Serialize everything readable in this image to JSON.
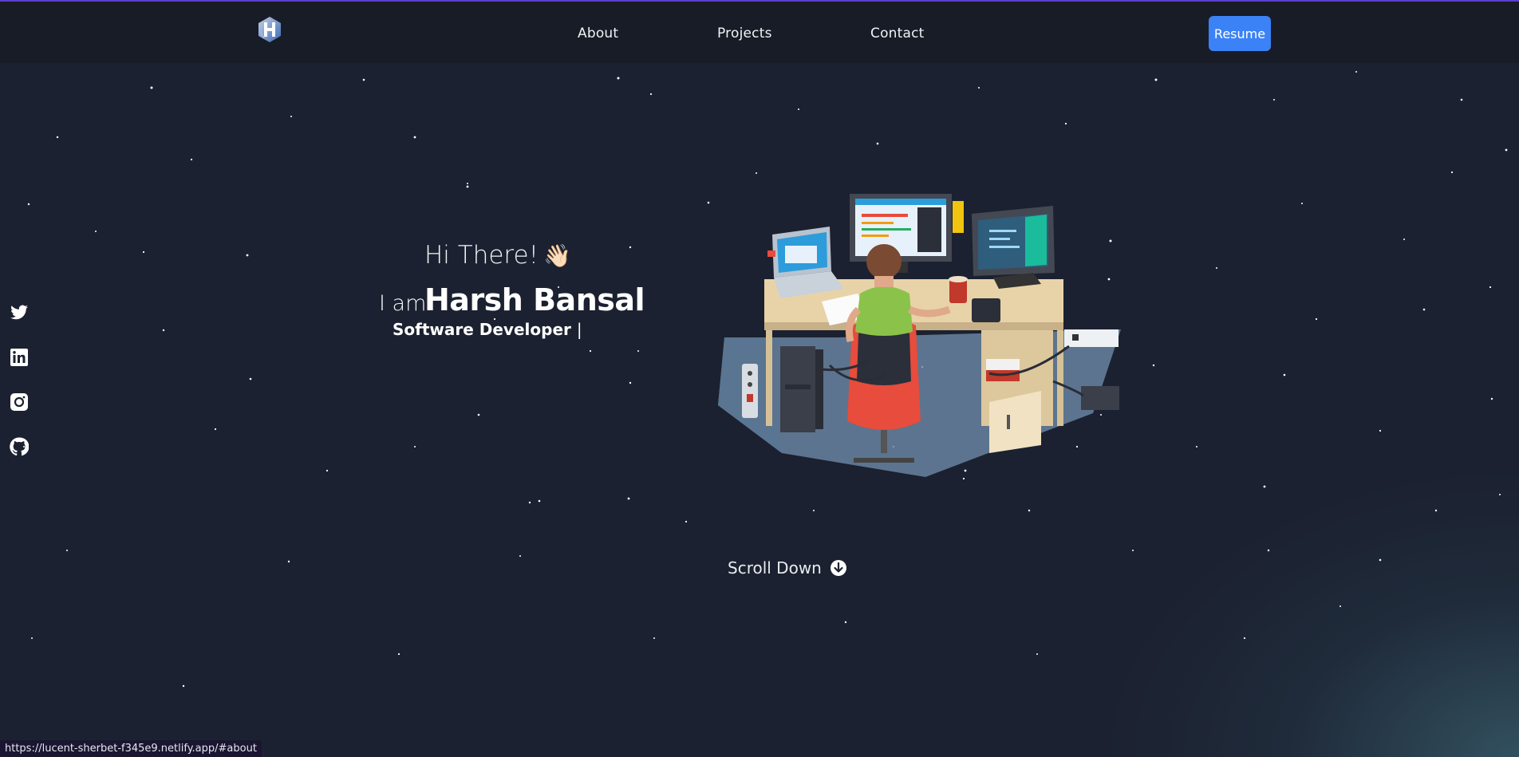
{
  "nav": {
    "links": [
      {
        "label": "About"
      },
      {
        "label": "Projects"
      },
      {
        "label": "Contact"
      }
    ],
    "resume_label": "Resume"
  },
  "hero": {
    "greeting": "Hi There!",
    "wave_emoji": "👋🏻",
    "intro": "I am",
    "name": "Harsh Bansal",
    "role": "Software Developer",
    "cursor": "|"
  },
  "social": [
    "twitter-icon",
    "linkedin-icon",
    "instagram-icon",
    "github-icon"
  ],
  "scroll": {
    "label": "Scroll Down"
  },
  "status_bar": {
    "url": "https://lucent-sherbet-f345e9.netlify.app/#about"
  },
  "colors": {
    "background": "#1b2130",
    "navbar": "#181c26",
    "accent": "#3b82f6",
    "top_line": "#5b3fd0"
  }
}
